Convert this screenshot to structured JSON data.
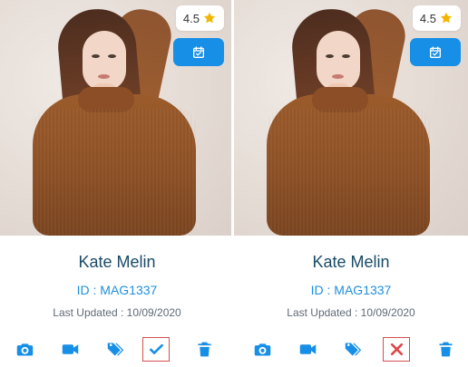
{
  "left_card": {
    "rating": "4.5",
    "name": "Kate Melin",
    "id": "ID : MAG1337",
    "updated": "Last Updated : 10/09/2020"
  },
  "right_card": {
    "rating": "4.5",
    "name": "Kate Melin",
    "id": "ID : MAG1337",
    "updated": "Last Updated : 10/09/2020"
  },
  "colors": {
    "accent": "#178fe7",
    "name": "#1a4a66",
    "id": "#1f8fde",
    "muted": "#5f6b76",
    "rating_star": "#f2b600",
    "selection_border": "#d24f4f",
    "reject_icon": "#e04545"
  },
  "icons": {
    "rating": "star-icon",
    "schedule": "calendar-check-icon",
    "camera": "camera-icon",
    "video": "video-camera-icon",
    "tags": "tags-icon",
    "approve": "check-icon",
    "reject": "close-icon",
    "delete": "trash-icon"
  }
}
